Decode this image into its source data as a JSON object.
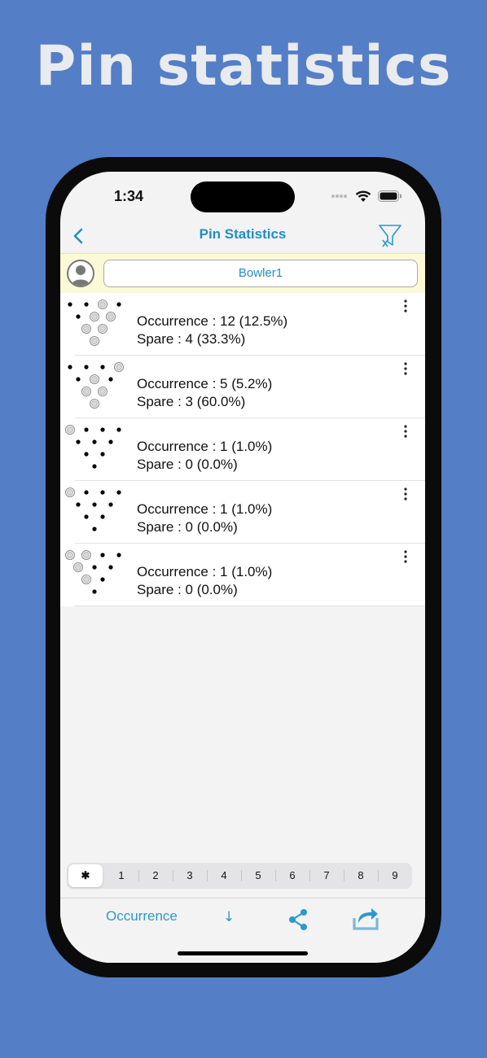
{
  "promo": {
    "title": "Pin statistics"
  },
  "status_bar": {
    "time": "1:34"
  },
  "nav": {
    "title": "Pin Statistics"
  },
  "bowler": {
    "name": "Bowler1"
  },
  "stats": [
    {
      "occurrence": "Occurrence : 12 (12.5%)",
      "spare": "Spare : 4 (33.3%)",
      "standing_pins": [
        4,
        7,
        8,
        10
      ],
      "knocked_pins": [
        1,
        2,
        3,
        5,
        6,
        9
      ]
    },
    {
      "occurrence": "Occurrence : 5 (5.2%)",
      "spare": "Spare : 3 (60.0%)",
      "standing_pins": [
        4,
        6,
        7,
        8,
        9
      ],
      "knocked_pins": [
        1,
        2,
        3,
        5,
        10
      ]
    },
    {
      "occurrence": "Occurrence : 1 (1.0%)",
      "spare": "Spare : 0 (0.0%)",
      "standing_pins": [
        1,
        2,
        3,
        4,
        5,
        6,
        8,
        9,
        10
      ],
      "knocked_pins": [
        7
      ]
    },
    {
      "occurrence": "Occurrence : 1 (1.0%)",
      "spare": "Spare : 0 (0.0%)",
      "standing_pins": [
        1,
        2,
        3,
        4,
        5,
        6,
        8,
        9,
        10
      ],
      "knocked_pins": [
        7
      ]
    },
    {
      "occurrence": "Occurrence : 1 (1.0%)",
      "spare": "Spare : 0 (0.0%)",
      "standing_pins": [
        1,
        3,
        5,
        6,
        9,
        10
      ],
      "knocked_pins": [
        2,
        4,
        7,
        8
      ]
    }
  ],
  "frames": {
    "labels": [
      "✱",
      "1",
      "2",
      "3",
      "4",
      "5",
      "6",
      "7",
      "8",
      "9"
    ],
    "selected": 0
  },
  "toolbar": {
    "sort_label": "Occurrence",
    "sort_arrow": "↓"
  },
  "icons": {
    "back": "chevron-left-icon",
    "filter": "filter-clear-icon",
    "more": "more-vertical-icon",
    "share": "share-icon",
    "export": "export-icon",
    "avatar": "person-icon"
  },
  "colors": {
    "background": "#547ec6",
    "accent": "#1f8fc2",
    "bowler_bar": "#fbf9d6"
  }
}
